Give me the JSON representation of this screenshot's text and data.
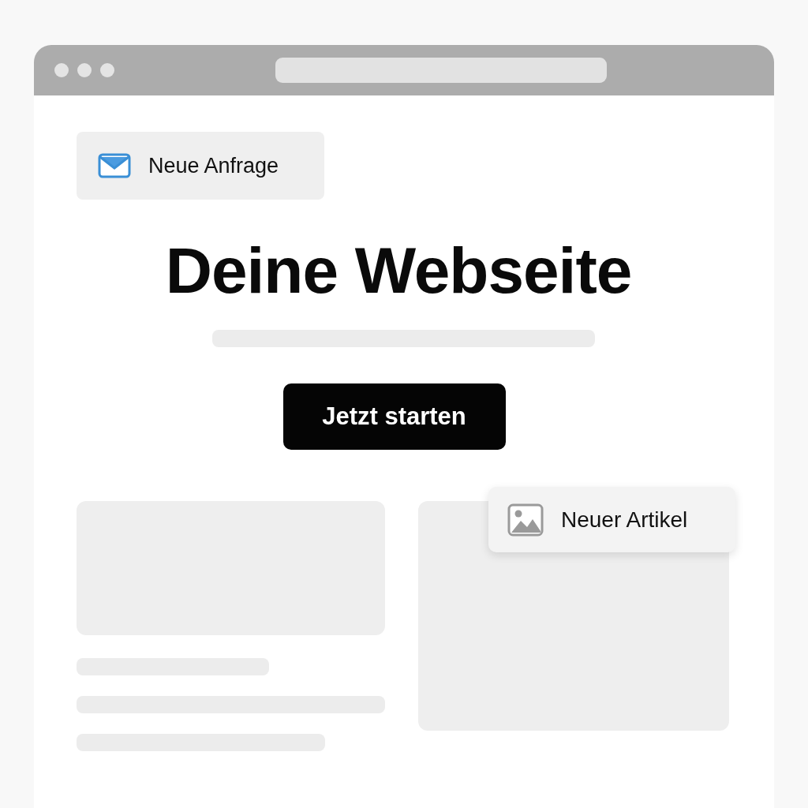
{
  "notification": {
    "label": "Neue Anfrage"
  },
  "hero": {
    "title": "Deine Webseite",
    "button": "Jetzt starten"
  },
  "floating_badge": {
    "label": "Neuer Artikel"
  }
}
